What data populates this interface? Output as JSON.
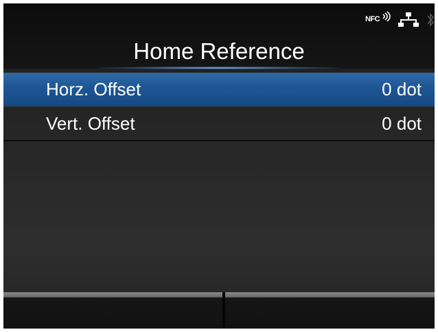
{
  "status_bar": {
    "nfc_label": "NFC",
    "icons": [
      "nfc-icon",
      "network-icon",
      "bluetooth-icon"
    ]
  },
  "header": {
    "title": "Home Reference"
  },
  "settings": [
    {
      "label": "Horz. Offset",
      "value": "0 dot",
      "selected": true
    },
    {
      "label": "Vert. Offset",
      "value": "0 dot",
      "selected": false
    }
  ],
  "softkeys": {
    "left_label": "",
    "right_label": ""
  },
  "colors": {
    "selection": "#1e5694",
    "background": "#262626",
    "text": "#ffffff"
  }
}
